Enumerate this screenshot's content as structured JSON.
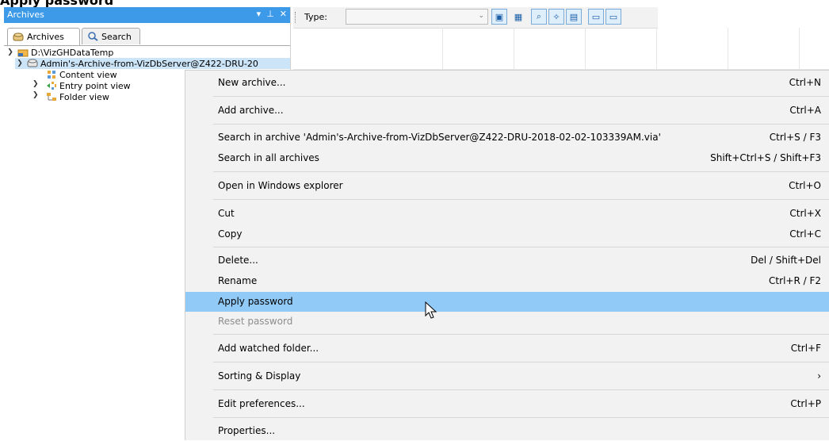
{
  "page_heading": "Apply password",
  "panel": {
    "title": "Archives",
    "controls": {
      "dropdown": "▾",
      "pin": "⊥",
      "close": "✕"
    },
    "tabs": [
      {
        "label": "Archives",
        "icon": "archive-icon"
      },
      {
        "label": "Search",
        "icon": "search-icon"
      }
    ]
  },
  "tree": {
    "root": {
      "label": "D:\\VizGHDataTemp",
      "icon": "folder-drive-icon"
    },
    "archive": {
      "label": "Admin's-Archive-from-VizDbServer@Z422-DRU-20",
      "icon": "archive-icon"
    },
    "children": [
      {
        "label": "Content view",
        "icon": "content-view-icon"
      },
      {
        "label": "Entry point view",
        "icon": "entry-point-icon"
      },
      {
        "label": "Folder view",
        "icon": "folder-view-icon"
      }
    ]
  },
  "toolbar": {
    "type_label": "Type:",
    "type_value": ""
  },
  "menu": {
    "items": [
      {
        "label": "New archive...",
        "shortcut": "Ctrl+N"
      },
      {
        "label": "Add archive...",
        "shortcut": "Ctrl+A"
      },
      {
        "label": "Search in archive 'Admin's-Archive-from-VizDbServer@Z422-DRU-2018-02-02-103339AM.via'",
        "shortcut": "Ctrl+S / F3"
      },
      {
        "label": "Search in all archives",
        "shortcut": "Shift+Ctrl+S / Shift+F3"
      },
      {
        "label": "Open in Windows explorer",
        "shortcut": "Ctrl+O"
      },
      {
        "label": "Cut",
        "shortcut": "Ctrl+X"
      },
      {
        "label": "Copy",
        "shortcut": "Ctrl+C"
      },
      {
        "label": "Delete...",
        "shortcut": "Del / Shift+Del"
      },
      {
        "label": "Rename",
        "shortcut": "Ctrl+R / F2"
      },
      {
        "label": "Apply password",
        "shortcut": ""
      },
      {
        "label": "Reset password",
        "shortcut": ""
      },
      {
        "label": "Add watched folder...",
        "shortcut": "Ctrl+F"
      },
      {
        "label": "Sorting & Display",
        "shortcut": "›"
      },
      {
        "label": "Edit preferences...",
        "shortcut": "Ctrl+P"
      },
      {
        "label": "Properties...",
        "shortcut": ""
      }
    ]
  },
  "colors": {
    "panel_header": "#3c9ae8",
    "highlight": "#91c9f7",
    "selection": "#cce4f7",
    "menu_bg": "#f2f2f2",
    "disabled_text": "#8d8d8d"
  }
}
